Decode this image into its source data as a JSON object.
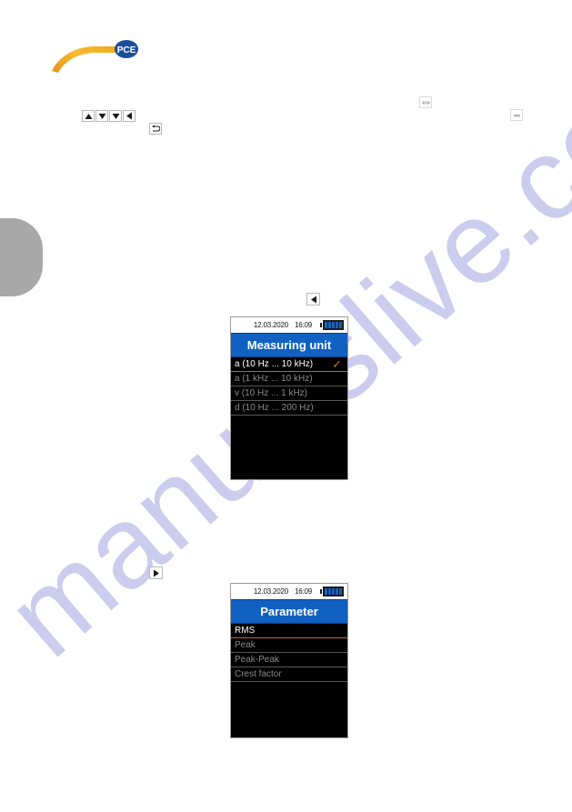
{
  "page": {
    "brand_logo_text": "PCE",
    "brand_accent": "#f5a623",
    "brand_blue": "#1b4f9c"
  },
  "watermark": {
    "text": "manualslive.com",
    "color": "#ccccee"
  },
  "toolbar_keys": [
    {
      "name": "up-arrow-key",
      "glyph": "up"
    },
    {
      "name": "down-arrow-key",
      "glyph": "down"
    },
    {
      "name": "down-arrow-key-2",
      "glyph": "down"
    },
    {
      "name": "left-arrow-key",
      "glyph": "left"
    },
    {
      "name": "back-key",
      "glyph": "back"
    },
    {
      "name": "faded-key-1",
      "glyph": "faded"
    },
    {
      "name": "faded-key-2",
      "glyph": "faded"
    }
  ],
  "inline_keys": {
    "left_key_glyph": "left",
    "right_key_glyph": "right"
  },
  "screens": [
    {
      "id": "measuring-unit",
      "status": {
        "date": "12.03.2020",
        "time": "16:09",
        "battery_cells": 5
      },
      "title": "Measuring unit",
      "items": [
        {
          "label": "a (10 Hz ... 10 kHz)",
          "selected": true,
          "checked": true
        },
        {
          "label": "a (1 kHz ... 10 kHz)",
          "selected": false,
          "checked": false
        },
        {
          "label": "v (10 Hz ... 1 kHz)",
          "selected": false,
          "checked": false
        },
        {
          "label": "d (10 Hz ... 200 Hz)",
          "selected": false,
          "checked": false
        }
      ]
    },
    {
      "id": "parameter",
      "status": {
        "date": "12.03.2020",
        "time": "16:09",
        "battery_cells": 5
      },
      "title": "Parameter",
      "items": [
        {
          "label": "RMS",
          "selected": true,
          "checked": false
        },
        {
          "label": "Peak",
          "selected": false,
          "checked": false
        },
        {
          "label": "Peak-Peak",
          "selected": false,
          "checked": false
        },
        {
          "label": "Crest factor",
          "selected": false,
          "checked": false
        }
      ]
    }
  ]
}
